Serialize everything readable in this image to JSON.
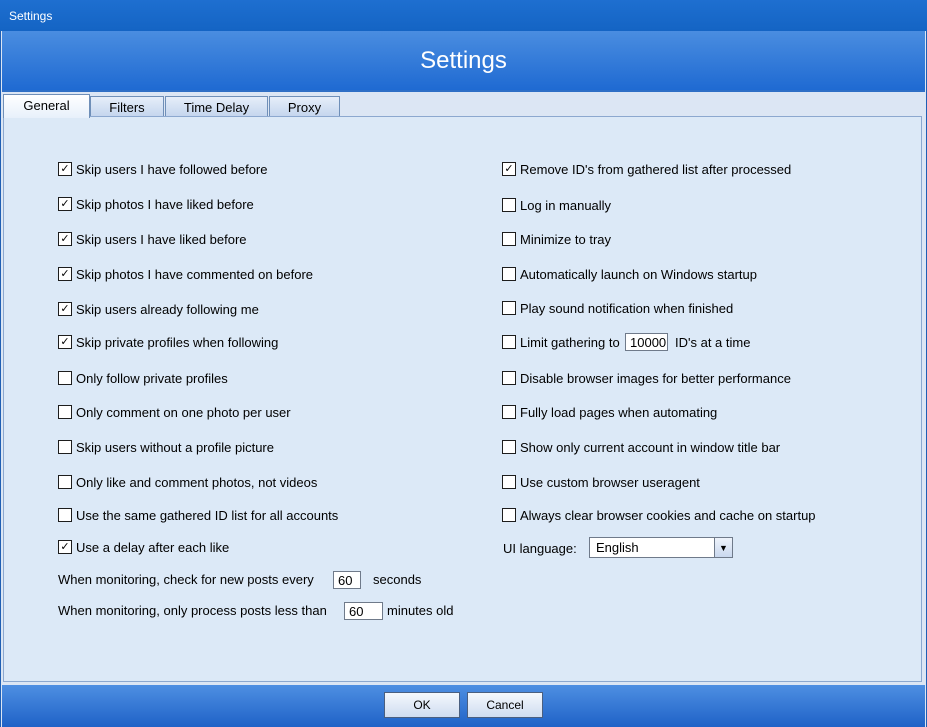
{
  "window": {
    "title": "Settings"
  },
  "header": {
    "title": "Settings"
  },
  "tabs": [
    "General",
    "Filters",
    "Time Delay",
    "Proxy"
  ],
  "left_options": [
    {
      "label": "Skip users I have followed before",
      "checked": true
    },
    {
      "label": "Skip photos I have liked before",
      "checked": true
    },
    {
      "label": "Skip users I have liked before",
      "checked": true
    },
    {
      "label": "Skip photos I have commented on before",
      "checked": true
    },
    {
      "label": "Skip users already following me",
      "checked": true
    },
    {
      "label": "Skip private profiles when following",
      "checked": true
    },
    {
      "label": "Only follow private profiles",
      "checked": false
    },
    {
      "label": "Only comment on one photo per user",
      "checked": false
    },
    {
      "label": "Skip users without a profile picture",
      "checked": false
    },
    {
      "label": "Only like and comment photos, not videos",
      "checked": false
    },
    {
      "label": "Use the same gathered ID list for all accounts",
      "checked": false
    },
    {
      "label": "Use a delay after each like",
      "checked": true
    }
  ],
  "right_options": [
    {
      "label": "Remove ID's from gathered list after processed",
      "checked": true
    },
    {
      "label": "Log in manually",
      "checked": false
    },
    {
      "label": "Minimize to tray",
      "checked": false
    },
    {
      "label": "Automatically launch on Windows startup",
      "checked": false
    },
    {
      "label": "Play sound notification when finished",
      "checked": false
    },
    {
      "label": "Limit gathering to",
      "checked": false
    },
    {
      "label": "Disable browser images for better performance",
      "checked": false
    },
    {
      "label": "Fully load pages when automating",
      "checked": false
    },
    {
      "label": "Show only current account in window title bar",
      "checked": false
    },
    {
      "label": "Use custom browser useragent",
      "checked": false
    },
    {
      "label": "Always clear browser cookies and cache on startup",
      "checked": false
    }
  ],
  "limit": {
    "value": "10000",
    "suffix": "ID's at a time"
  },
  "monitor_check": {
    "prefix": "When monitoring, check for new posts every",
    "value": "60",
    "suffix": "seconds"
  },
  "monitor_age": {
    "prefix": "When monitoring, only process posts less than",
    "value": "60",
    "suffix": "minutes old"
  },
  "language": {
    "label": "UI language:",
    "value": "English"
  },
  "buttons": {
    "ok": "OK",
    "cancel": "Cancel"
  }
}
